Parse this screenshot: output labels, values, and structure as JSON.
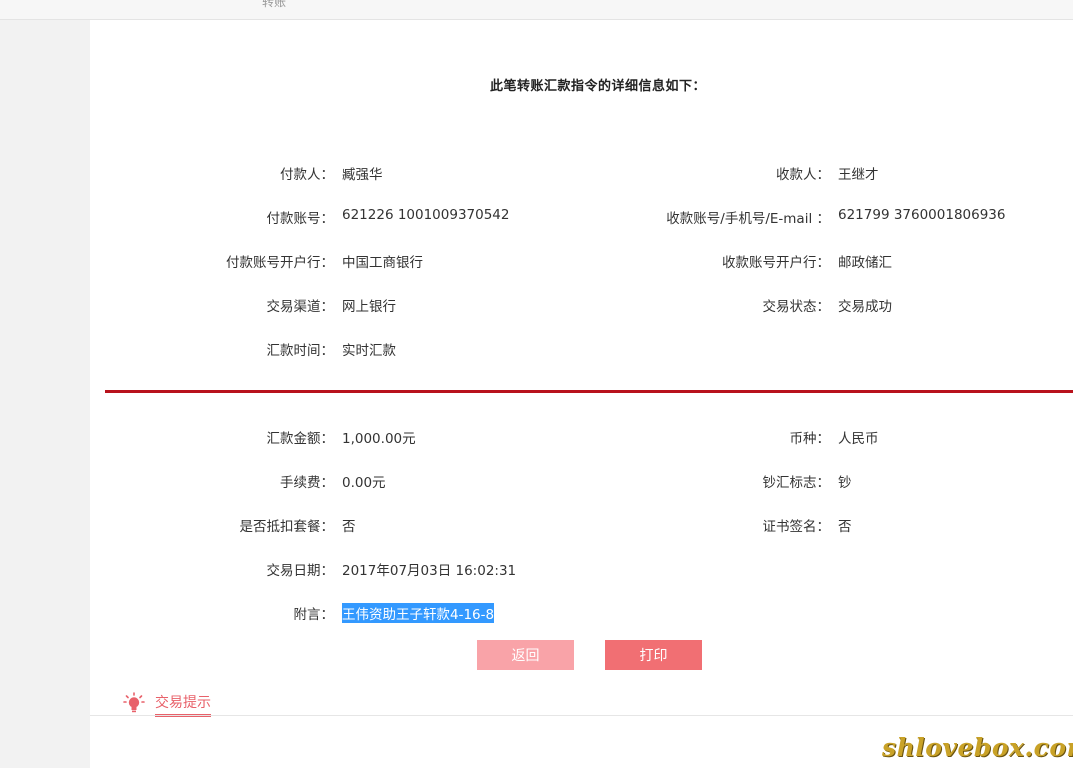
{
  "header": {
    "breadcrumb": "转账"
  },
  "detail": {
    "title": "此笔转账汇款指令的详细信息如下：",
    "payer": {
      "label": "付款人：",
      "value": "臧强华"
    },
    "payee": {
      "label": "收款人：",
      "value": "王继才"
    },
    "payer_account": {
      "label": "付款账号：",
      "value": "621226 1001009370542"
    },
    "payee_account": {
      "label": "收款账号/手机号/E-mail ：",
      "value": "621799 3760001806936"
    },
    "payer_bank": {
      "label": "付款账号开户行：",
      "value": "中国工商银行"
    },
    "payee_bank": {
      "label": "收款账号开户行：",
      "value": "邮政储汇"
    },
    "channel": {
      "label": "交易渠道：",
      "value": "网上银行"
    },
    "status": {
      "label": "交易状态：",
      "value": "交易成功"
    },
    "remit_time": {
      "label": "汇款时间：",
      "value": "实时汇款"
    },
    "amount": {
      "label": "汇款金额：",
      "value": "1,000.00元"
    },
    "currency": {
      "label": "币种：",
      "value": "人民币"
    },
    "fee": {
      "label": "手续费：",
      "value": "0.00元"
    },
    "cash_flag": {
      "label": "钞汇标志：",
      "value": "钞"
    },
    "package_deduct": {
      "label": "是否抵扣套餐：",
      "value": "否"
    },
    "cert_sign": {
      "label": "证书签名：",
      "value": "否"
    },
    "trade_date": {
      "label": "交易日期：",
      "value": "2017年07月03日 16:02:31"
    },
    "memo": {
      "label": "附言：",
      "value": "王伟资助王子轩款4-16-8"
    }
  },
  "actions": {
    "back_label": "返回",
    "print_label": "打印"
  },
  "tips": {
    "label": "交易提示",
    "icon": "lightbulb-icon"
  },
  "watermark": "shlovebox.com",
  "colors": {
    "divider": "#b8121c",
    "back_button": "#f9a3a8",
    "print_button": "#f16f73",
    "accent": "#e8616a"
  }
}
